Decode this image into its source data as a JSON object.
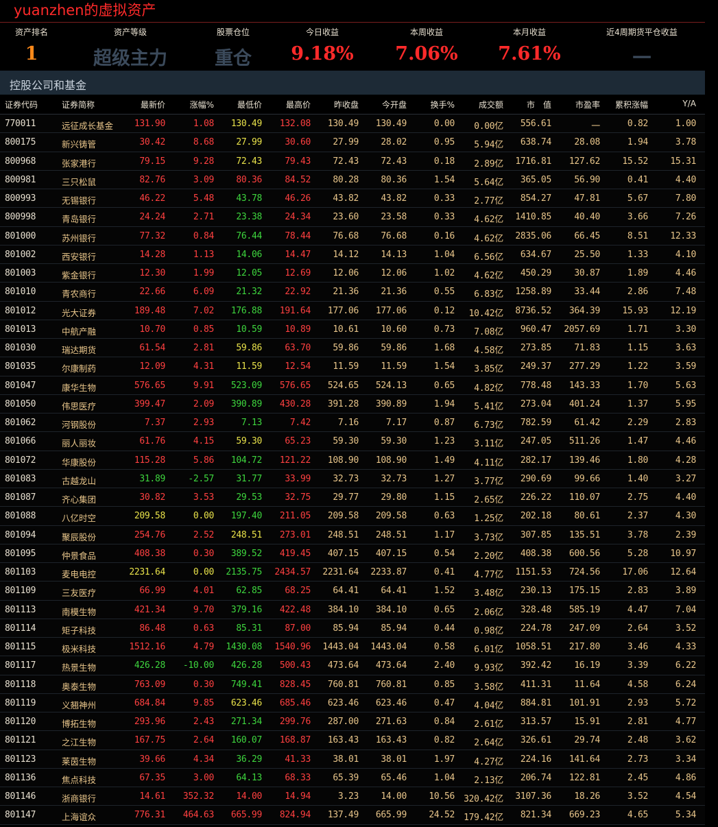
{
  "app_title": "yuanzhen的虚拟资产",
  "summary": [
    {
      "label": "资产排名",
      "value": "1",
      "color": "#ff8a1a"
    },
    {
      "label": "资产等级",
      "value": "超级主力",
      "color": "#3b4a5b"
    },
    {
      "label": "股票仓位",
      "value": "重仓",
      "color": "#3b4a5b"
    },
    {
      "label": "今日收益",
      "value": "9.18%",
      "color": "#ff2a2a"
    },
    {
      "label": "本周收益",
      "value": "7.06%",
      "color": "#ff2a2a"
    },
    {
      "label": "本月收益",
      "value": "7.61%",
      "color": "#ff2a2a"
    },
    {
      "label": "近4周期货平仓收益",
      "value": "一",
      "color": "#3b4a5b"
    }
  ],
  "section_title": "控股公司和基金",
  "columns": [
    "证券代码",
    "证券简称",
    "最新价",
    "涨幅%",
    "最低价",
    "最高价",
    "昨收盘",
    "今开盘",
    "换手%",
    "成交额",
    "市　值",
    "市盈率",
    "累积涨幅",
    "Y/A"
  ],
  "rows": [
    [
      "770011",
      "远征成长基金",
      "131.90",
      "1.08",
      "130.49",
      "132.08",
      "130.49",
      "130.49",
      "0.00",
      "0.00亿",
      "556.61",
      "一",
      "0.82",
      "1.00"
    ],
    [
      "800175",
      "新兴铸管",
      "30.42",
      "8.68",
      "27.99",
      "30.60",
      "27.99",
      "28.02",
      "0.95",
      "5.94亿",
      "638.74",
      "28.08",
      "1.94",
      "3.78"
    ],
    [
      "800968",
      "张家港行",
      "79.15",
      "9.28",
      "72.43",
      "79.43",
      "72.43",
      "72.43",
      "0.18",
      "2.89亿",
      "1716.81",
      "127.62",
      "15.52",
      "15.31"
    ],
    [
      "800981",
      "三只松鼠",
      "82.76",
      "3.09",
      "80.36",
      "84.52",
      "80.28",
      "80.36",
      "1.54",
      "5.64亿",
      "365.05",
      "56.90",
      "0.41",
      "4.40"
    ],
    [
      "800993",
      "无锡银行",
      "46.22",
      "5.48",
      "43.78",
      "46.26",
      "43.82",
      "43.82",
      "0.33",
      "2.77亿",
      "854.27",
      "47.81",
      "5.67",
      "7.80"
    ],
    [
      "800998",
      "青岛银行",
      "24.24",
      "2.71",
      "23.38",
      "24.34",
      "23.60",
      "23.58",
      "0.33",
      "4.62亿",
      "1410.85",
      "40.40",
      "3.66",
      "7.26"
    ],
    [
      "801000",
      "苏州银行",
      "77.32",
      "0.84",
      "76.44",
      "78.44",
      "76.68",
      "76.68",
      "0.16",
      "4.62亿",
      "2835.06",
      "66.45",
      "8.51",
      "12.33"
    ],
    [
      "801002",
      "西安银行",
      "14.28",
      "1.13",
      "14.06",
      "14.47",
      "14.12",
      "14.13",
      "1.04",
      "6.56亿",
      "634.67",
      "25.50",
      "1.33",
      "4.10"
    ],
    [
      "801003",
      "紫金银行",
      "12.30",
      "1.99",
      "12.05",
      "12.69",
      "12.06",
      "12.06",
      "1.02",
      "4.62亿",
      "450.29",
      "30.87",
      "1.89",
      "4.46"
    ],
    [
      "801010",
      "青农商行",
      "22.66",
      "6.09",
      "21.32",
      "22.92",
      "21.36",
      "21.36",
      "0.55",
      "6.83亿",
      "1258.89",
      "33.44",
      "2.86",
      "7.48"
    ],
    [
      "801012",
      "光大证券",
      "189.48",
      "7.02",
      "176.88",
      "191.64",
      "177.06",
      "177.06",
      "0.12",
      "10.42亿",
      "8736.52",
      "364.39",
      "15.93",
      "12.19"
    ],
    [
      "801013",
      "中航产融",
      "10.70",
      "0.85",
      "10.59",
      "10.89",
      "10.61",
      "10.60",
      "0.73",
      "7.08亿",
      "960.47",
      "2057.69",
      "1.71",
      "3.30"
    ],
    [
      "801030",
      "瑞达期货",
      "61.54",
      "2.81",
      "59.86",
      "63.70",
      "59.86",
      "59.86",
      "1.68",
      "4.58亿",
      "273.85",
      "71.83",
      "1.15",
      "3.63"
    ],
    [
      "801035",
      "尔康制药",
      "12.09",
      "4.31",
      "11.59",
      "12.54",
      "11.59",
      "11.59",
      "1.54",
      "3.85亿",
      "249.37",
      "277.29",
      "1.22",
      "3.59"
    ],
    [
      "801047",
      "康华生物",
      "576.65",
      "9.91",
      "523.09",
      "576.65",
      "524.65",
      "524.13",
      "0.65",
      "4.82亿",
      "778.48",
      "143.33",
      "1.70",
      "5.63"
    ],
    [
      "801050",
      "伟思医疗",
      "399.47",
      "2.09",
      "390.89",
      "430.28",
      "391.28",
      "390.89",
      "1.94",
      "5.41亿",
      "273.04",
      "401.24",
      "1.37",
      "5.95"
    ],
    [
      "801062",
      "河钢股份",
      "7.37",
      "2.93",
      "7.13",
      "7.42",
      "7.16",
      "7.17",
      "0.87",
      "6.73亿",
      "782.59",
      "61.42",
      "2.29",
      "2.83"
    ],
    [
      "801066",
      "丽人丽妆",
      "61.76",
      "4.15",
      "59.30",
      "65.23",
      "59.30",
      "59.30",
      "1.23",
      "3.11亿",
      "247.05",
      "511.26",
      "1.47",
      "4.46"
    ],
    [
      "801072",
      "华康股份",
      "115.28",
      "5.86",
      "104.72",
      "121.22",
      "108.90",
      "108.90",
      "1.49",
      "4.11亿",
      "282.17",
      "139.46",
      "1.80",
      "4.28"
    ],
    [
      "801083",
      "古越龙山",
      "31.89",
      "-2.57",
      "31.77",
      "33.99",
      "32.73",
      "32.73",
      "1.27",
      "3.77亿",
      "290.69",
      "99.66",
      "1.40",
      "3.27"
    ],
    [
      "801087",
      "齐心集团",
      "30.82",
      "3.53",
      "29.53",
      "32.75",
      "29.77",
      "29.80",
      "1.15",
      "2.65亿",
      "226.22",
      "110.07",
      "2.75",
      "4.40"
    ],
    [
      "801088",
      "八亿时空",
      "209.58",
      "0.00",
      "197.40",
      "211.05",
      "209.58",
      "209.58",
      "0.63",
      "1.25亿",
      "202.18",
      "80.61",
      "2.37",
      "4.30"
    ],
    [
      "801094",
      "聚辰股份",
      "254.76",
      "2.52",
      "248.51",
      "273.01",
      "248.51",
      "248.51",
      "1.17",
      "3.73亿",
      "307.85",
      "135.51",
      "3.78",
      "2.39"
    ],
    [
      "801095",
      "仲景食品",
      "408.38",
      "0.30",
      "389.52",
      "419.45",
      "407.15",
      "407.15",
      "0.54",
      "2.20亿",
      "408.38",
      "600.56",
      "5.28",
      "10.97"
    ],
    [
      "801103",
      "麦电电控",
      "2231.64",
      "0.00",
      "2135.75",
      "2434.57",
      "2231.64",
      "2233.87",
      "0.41",
      "4.77亿",
      "1151.53",
      "724.56",
      "17.06",
      "12.64"
    ],
    [
      "801109",
      "三友医疗",
      "66.99",
      "4.01",
      "62.85",
      "68.25",
      "64.41",
      "64.41",
      "1.52",
      "3.48亿",
      "230.13",
      "175.15",
      "2.83",
      "3.89"
    ],
    [
      "801113",
      "南模生物",
      "421.34",
      "9.70",
      "379.16",
      "422.48",
      "384.10",
      "384.10",
      "0.65",
      "2.06亿",
      "328.48",
      "585.19",
      "4.47",
      "7.04"
    ],
    [
      "801114",
      "矩子科技",
      "86.48",
      "0.63",
      "85.31",
      "87.00",
      "85.94",
      "85.94",
      "0.44",
      "0.98亿",
      "224.78",
      "247.09",
      "2.64",
      "3.52"
    ],
    [
      "801115",
      "极米科技",
      "1512.16",
      "4.79",
      "1430.08",
      "1540.96",
      "1443.04",
      "1443.04",
      "0.58",
      "6.01亿",
      "1058.51",
      "217.80",
      "3.46",
      "4.33"
    ],
    [
      "801117",
      "热景生物",
      "426.28",
      "-10.00",
      "426.28",
      "500.43",
      "473.64",
      "473.64",
      "2.40",
      "9.93亿",
      "392.42",
      "16.19",
      "3.39",
      "6.22"
    ],
    [
      "801118",
      "奥泰生物",
      "763.09",
      "0.30",
      "749.41",
      "828.45",
      "760.81",
      "760.81",
      "0.85",
      "3.58亿",
      "411.31",
      "11.64",
      "4.58",
      "6.24"
    ],
    [
      "801119",
      "义翘神州",
      "684.84",
      "9.85",
      "623.46",
      "685.46",
      "623.46",
      "623.46",
      "0.47",
      "4.04亿",
      "884.81",
      "101.91",
      "2.93",
      "5.72"
    ],
    [
      "801120",
      "博拓生物",
      "293.96",
      "2.43",
      "271.34",
      "299.76",
      "287.00",
      "271.63",
      "0.84",
      "2.61亿",
      "313.57",
      "15.91",
      "2.81",
      "4.77"
    ],
    [
      "801121",
      "之江生物",
      "167.75",
      "2.64",
      "160.07",
      "168.87",
      "163.43",
      "163.43",
      "0.82",
      "2.64亿",
      "326.61",
      "29.74",
      "2.48",
      "3.62"
    ],
    [
      "801123",
      "莱茵生物",
      "39.66",
      "4.34",
      "36.29",
      "41.33",
      "38.01",
      "38.01",
      "1.97",
      "4.27亿",
      "224.16",
      "141.64",
      "2.73",
      "3.34"
    ],
    [
      "801136",
      "焦点科技",
      "67.35",
      "3.00",
      "64.13",
      "68.33",
      "65.39",
      "65.46",
      "1.04",
      "2.13亿",
      "206.74",
      "122.81",
      "2.45",
      "4.86"
    ],
    [
      "801146",
      "浙商银行",
      "14.61",
      "352.32",
      "14.00",
      "14.94",
      "3.23",
      "14.00",
      "10.56",
      "320.42亿",
      "3107.36",
      "18.26",
      "3.52",
      "4.54"
    ],
    [
      "801147",
      "上海谊众",
      "776.31",
      "464.63",
      "665.99",
      "824.94",
      "137.49",
      "665.99",
      "24.52",
      "179.42亿",
      "821.34",
      "669.23",
      "4.65",
      "5.34"
    ]
  ]
}
